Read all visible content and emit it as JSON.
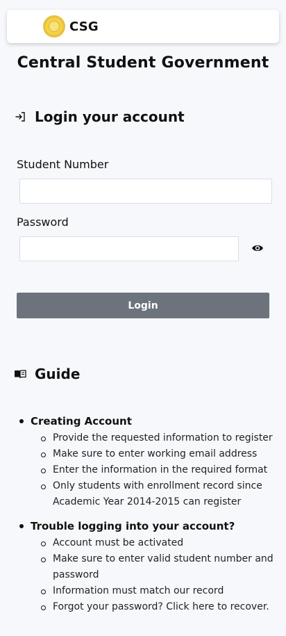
{
  "header": {
    "brand": "CSG",
    "logo_icon": "seal-logo-icon"
  },
  "page": {
    "title": "Central Student Government"
  },
  "login": {
    "section_title": "Login your account",
    "section_icon": "login-arrow-icon",
    "student_number_label": "Student Number",
    "student_number_value": "",
    "password_label": "Password",
    "password_value": "",
    "toggle_icon": "eye-icon",
    "button_label": "Login",
    "button_color": "#6c737d"
  },
  "guide": {
    "section_title": "Guide",
    "section_icon": "book-icon",
    "groups": [
      {
        "title": "Creating Account",
        "items": [
          "Provide the requested information to register",
          "Make sure to enter working email address",
          "Enter the information in the required format",
          "Only students with enrollment record since Academic Year 2014-2015 can register"
        ]
      },
      {
        "title": "Trouble logging into your account?",
        "items": [
          "Account must be activated",
          "Make sure to enter valid student number and password",
          "Information must match our record",
          "Forgot your password? Click here to recover."
        ]
      }
    ]
  }
}
